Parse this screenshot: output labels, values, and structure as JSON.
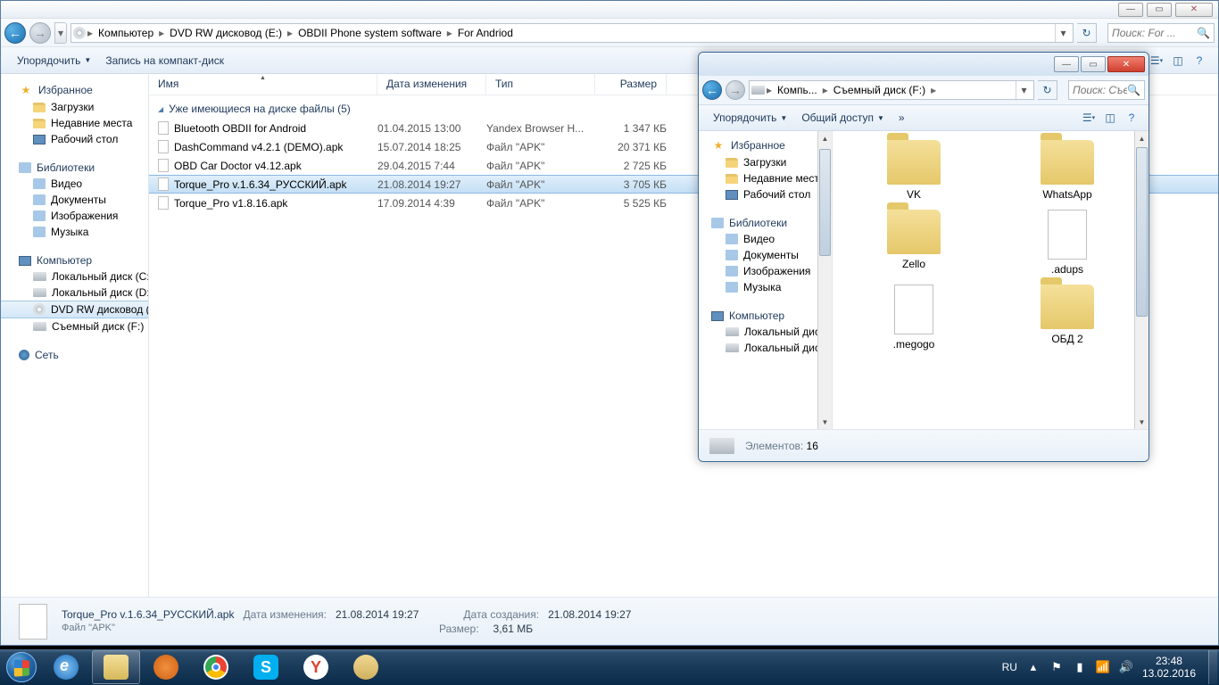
{
  "main": {
    "breadcrumbs": [
      "Компьютер",
      "DVD RW дисковод (E:)",
      "OBDII Phone system software",
      "For Andriod"
    ],
    "search_placeholder": "Поиск: For ...",
    "toolbar": {
      "organize": "Упорядочить",
      "burn": "Запись на компакт-диск"
    },
    "columns": {
      "name": "Имя",
      "date": "Дата изменения",
      "type": "Тип",
      "size": "Размер"
    },
    "group_header": "Уже имеющиеся на диске файлы (5)",
    "files": [
      {
        "name": "Bluetooth OBDII for Android",
        "date": "01.04.2015 13:00",
        "type": "Yandex Browser H...",
        "size": "1 347 КБ",
        "selected": false
      },
      {
        "name": "DashCommand v4.2.1 (DEMO).apk",
        "date": "15.07.2014 18:25",
        "type": "Файл \"APK\"",
        "size": "20 371 КБ",
        "selected": false
      },
      {
        "name": "OBD Car Doctor v4.12.apk",
        "date": "29.04.2015 7:44",
        "type": "Файл \"APK\"",
        "size": "2 725 КБ",
        "selected": false
      },
      {
        "name": "Torque_Pro v.1.6.34_РУССКИЙ.apk",
        "date": "21.08.2014 19:27",
        "type": "Файл \"APK\"",
        "size": "3 705 КБ",
        "selected": true
      },
      {
        "name": "Torque_Pro v1.8.16.apk",
        "date": "17.09.2014 4:39",
        "type": "Файл \"APK\"",
        "size": "5 525 КБ",
        "selected": false
      }
    ],
    "nav": {
      "favorites": {
        "label": "Избранное",
        "items": [
          "Загрузки",
          "Недавние места",
          "Рабочий стол"
        ]
      },
      "libraries": {
        "label": "Библиотеки",
        "items": [
          "Видео",
          "Документы",
          "Изображения",
          "Музыка"
        ]
      },
      "computer": {
        "label": "Компьютер",
        "items": [
          "Локальный диск (C:)",
          "Локальный диск (D:)",
          "DVD RW дисковод (E:)",
          "Съемный диск (F:)"
        ]
      },
      "network": {
        "label": "Сеть"
      }
    },
    "details": {
      "name": "Torque_Pro v.1.6.34_РУССКИЙ.apk",
      "type": "Файл \"APK\"",
      "date_mod_label": "Дата изменения:",
      "date_mod": "21.08.2014 19:27",
      "size_label": "Размер:",
      "size": "3,61 МБ",
      "date_cr_label": "Дата создания:",
      "date_cr": "21.08.2014 19:27"
    }
  },
  "sec": {
    "breadcrumbs": [
      "Компь...",
      "Съемный диск (F:)"
    ],
    "search_placeholder": "Поиск: Съе...",
    "toolbar": {
      "organize": "Упорядочить",
      "share": "Общий доступ",
      "more": "»"
    },
    "nav": {
      "favorites": {
        "label": "Избранное",
        "items": [
          "Загрузки",
          "Недавние места",
          "Рабочий стол"
        ]
      },
      "libraries": {
        "label": "Библиотеки",
        "items": [
          "Видео",
          "Документы",
          "Изображения",
          "Музыка"
        ]
      },
      "computer": {
        "label": "Компьютер",
        "items": [
          "Локальный диск (C:)",
          "Локальный диск (D:)"
        ]
      }
    },
    "items": [
      {
        "name": "VK",
        "kind": "folder-img"
      },
      {
        "name": "WhatsApp",
        "kind": "folder"
      },
      {
        "name": "Zello",
        "kind": "folder-open"
      },
      {
        "name": ".adups",
        "kind": "file"
      },
      {
        "name": ".megogo",
        "kind": "file"
      },
      {
        "name": "ОБД 2",
        "kind": "folder"
      }
    ],
    "status": {
      "label": "Элементов:",
      "count": "16"
    }
  },
  "taskbar": {
    "lang": "RU",
    "time": "23:48",
    "date": "13.02.2016"
  }
}
